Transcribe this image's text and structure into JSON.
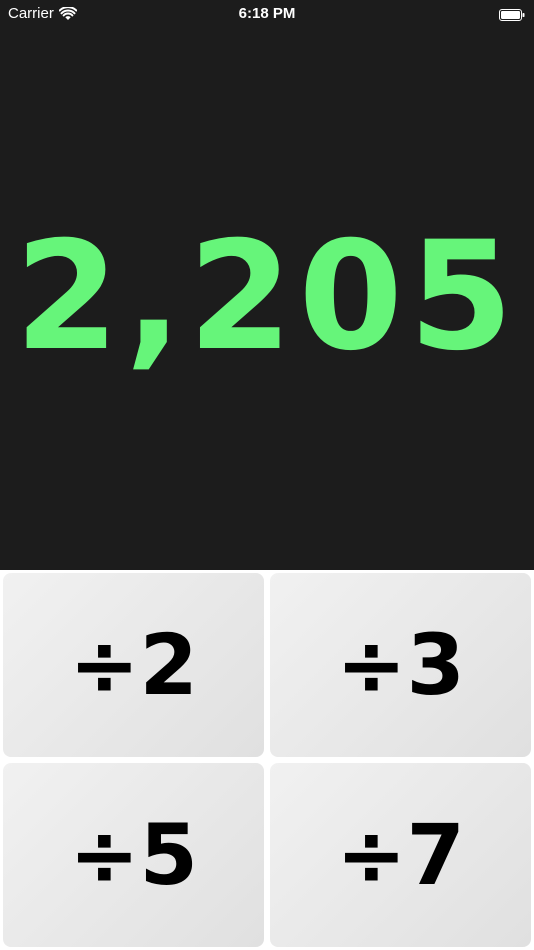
{
  "status_bar": {
    "carrier": "Carrier",
    "time": "6:18 PM",
    "icons": [
      "wifi-icon",
      "battery-icon"
    ]
  },
  "display": {
    "value": "2,205",
    "color": "#66f57a",
    "background": "#1c1c1c"
  },
  "buttons": [
    {
      "label": "÷2"
    },
    {
      "label": "÷3"
    },
    {
      "label": "÷5"
    },
    {
      "label": "÷7"
    }
  ]
}
